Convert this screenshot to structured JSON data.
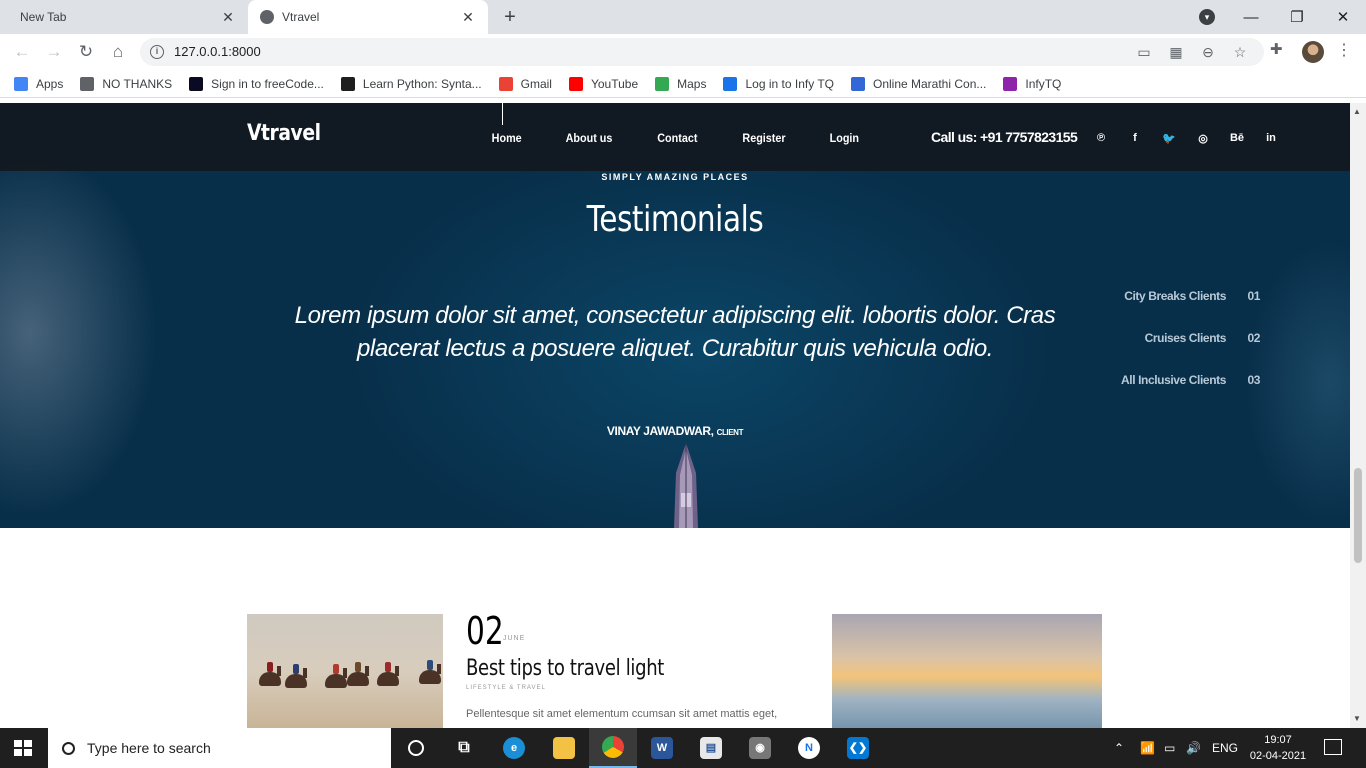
{
  "browser": {
    "tabs": [
      {
        "title": "New Tab"
      },
      {
        "title": "Vtravel"
      }
    ],
    "url": "127.0.0.1:8000",
    "bookmarks": [
      {
        "label": "Apps",
        "icon": "apps-grid-icon",
        "color": "#4285f4"
      },
      {
        "label": "NO THANKS",
        "icon": "globe-icon",
        "color": "#5f6368"
      },
      {
        "label": "Sign in to freeCode...",
        "icon": "freecodecamp-icon",
        "color": "#0a0a23"
      },
      {
        "label": "Learn Python: Synta...",
        "icon": "codecademy-icon",
        "color": "#1f1f1f"
      },
      {
        "label": "Gmail",
        "icon": "gmail-icon",
        "color": "#ea4335"
      },
      {
        "label": "YouTube",
        "icon": "youtube-icon",
        "color": "#ff0000"
      },
      {
        "label": "Maps",
        "icon": "maps-icon",
        "color": "#34a853"
      },
      {
        "label": "Log in to Infy TQ",
        "icon": "infytq-icon",
        "color": "#1a73e8"
      },
      {
        "label": "Online Marathi Con...",
        "icon": "shield-icon",
        "color": "#3367d6"
      },
      {
        "label": "InfyTQ",
        "icon": "infytq-logo-icon",
        "color": "#8e24aa"
      }
    ]
  },
  "site": {
    "brand": "Vtravel",
    "menu": [
      "Home",
      "About us",
      "Contact",
      "Register",
      "Login"
    ],
    "call": "Call us: +91 7757823155",
    "social": [
      "℗",
      "f",
      "🐦",
      "◎",
      "Bē",
      "in"
    ],
    "social_names": [
      "pinterest-icon",
      "facebook-icon",
      "twitter-icon",
      "dribbble-icon",
      "behance-icon",
      "linkedin-icon"
    ]
  },
  "testimonials": {
    "eyebrow": "SIMPLY AMAZING PLACES",
    "heading": "Testimonials",
    "quote": "Lorem ipsum dolor sit amet, consectetur adipiscing elit. lobortis dolor. Cras placerat lectus a posuere aliquet. Curabitur quis vehicula odio.",
    "author": "VINAY JAWADWAR,",
    "author_role": "CLIENT",
    "clients": [
      {
        "label": "City Breaks Clients",
        "num": "01"
      },
      {
        "label": "Cruises Clients",
        "num": "02"
      },
      {
        "label": "All Inclusive Clients",
        "num": "03"
      }
    ]
  },
  "post": {
    "day": "02",
    "month": "JUNE",
    "title": "Best tips to travel light",
    "category": "LIFESTYLE & TRAVEL",
    "excerpt": "Pellentesque sit amet elementum ccumsan sit amet mattis eget,"
  },
  "taskbar": {
    "search_placeholder": "Type here to search",
    "language": "ENG",
    "time": "19:07",
    "date": "02-04-2021"
  }
}
